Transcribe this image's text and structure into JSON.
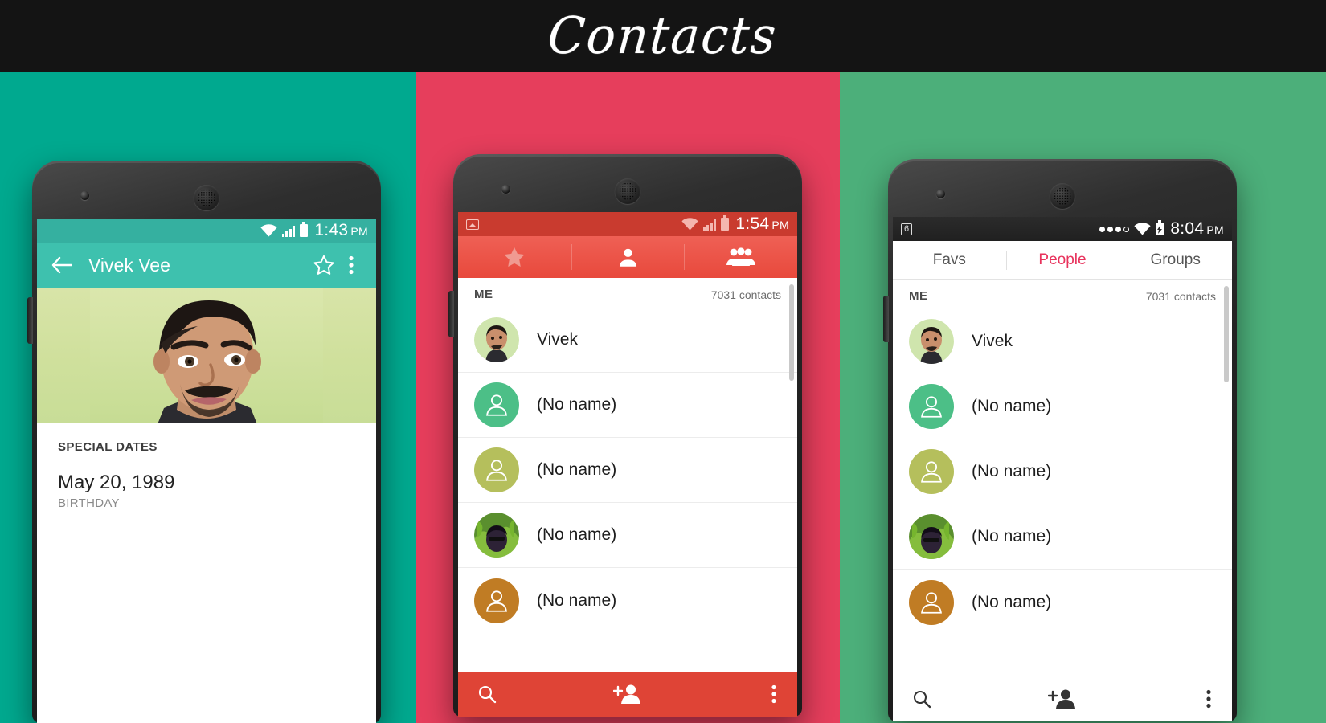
{
  "banner": {
    "title": "Contacts",
    "bg": "#141414",
    "text_color": "#ffffff"
  },
  "panels": [
    {
      "name": "teal",
      "color": "#00a98f"
    },
    {
      "name": "pink",
      "color": "#e63e5c"
    },
    {
      "name": "green",
      "color": "#4caf7a"
    }
  ],
  "phone1": {
    "theme_color": "#3ec1ae",
    "statusbar": {
      "time": "1:43",
      "ampm": "PM",
      "icons": [
        "wifi-icon",
        "signal-bars-icon",
        "battery-icon"
      ]
    },
    "toolbar": {
      "back_icon": "back-arrow-icon",
      "title": "Vivek Vee",
      "star_icon": "star-outline-icon",
      "overflow_icon": "overflow-menu-icon"
    },
    "hero": {
      "alt": "contact photo"
    },
    "details": {
      "section_header": "SPECIAL DATES",
      "date_value": "May 20, 1989",
      "date_label": "BIRTHDAY"
    }
  },
  "phone2": {
    "theme_color": "#df4436",
    "statusbar": {
      "time": "1:54",
      "ampm": "PM",
      "left_icon": "image-badge-icon",
      "icons": [
        "wifi-icon",
        "signal-bars-icon",
        "battery-icon"
      ]
    },
    "tabs": [
      {
        "icon": "star-filled-icon",
        "name": "favs",
        "active": false
      },
      {
        "icon": "person-icon",
        "name": "people",
        "active": true
      },
      {
        "icon": "group-people-icon",
        "name": "groups",
        "active": false
      }
    ],
    "list": {
      "header_label": "ME",
      "count_label": "7031 contacts",
      "rows": [
        {
          "name": "Vivek",
          "avatar_type": "photo",
          "avatar_color": "#cfe5ad"
        },
        {
          "name": "(No name)",
          "avatar_type": "letter",
          "avatar_color": "#4cbf87"
        },
        {
          "name": "(No name)",
          "avatar_type": "letter",
          "avatar_color": "#b5bf5c"
        },
        {
          "name": "(No name)",
          "avatar_type": "photo2",
          "avatar_color": "#3b5d2a"
        },
        {
          "name": "(No name)",
          "avatar_type": "letter",
          "avatar_color": "#c07c24"
        }
      ]
    },
    "bottombar": {
      "search_icon": "search-icon",
      "add_contact_icon": "add-person-icon",
      "overflow_icon": "overflow-menu-icon"
    }
  },
  "phone3": {
    "theme_color": "#ffffff",
    "accent": "#e8325c",
    "statusbar": {
      "time": "8:04",
      "ampm": "PM",
      "sim_badge": "6",
      "icons": [
        "signal-dots-icon",
        "wifi-icon",
        "battery-charging-icon"
      ]
    },
    "tabs": [
      {
        "label": "Favs",
        "active": false
      },
      {
        "label": "People",
        "active": true
      },
      {
        "label": "Groups",
        "active": false
      }
    ],
    "list": {
      "header_label": "ME",
      "count_label": "7031 contacts",
      "rows": [
        {
          "name": "Vivek",
          "avatar_type": "photo",
          "avatar_color": "#cfe5ad"
        },
        {
          "name": "(No name)",
          "avatar_type": "letter",
          "avatar_color": "#4cbf87"
        },
        {
          "name": "(No name)",
          "avatar_type": "letter",
          "avatar_color": "#b5bf5c"
        },
        {
          "name": "(No name)",
          "avatar_type": "photo2",
          "avatar_color": "#3b5d2a"
        },
        {
          "name": "(No name)",
          "avatar_type": "letter",
          "avatar_color": "#c07c24"
        }
      ]
    },
    "bottombar": {
      "search_icon": "search-icon",
      "add_contact_icon": "add-person-icon",
      "overflow_icon": "overflow-menu-icon"
    }
  }
}
